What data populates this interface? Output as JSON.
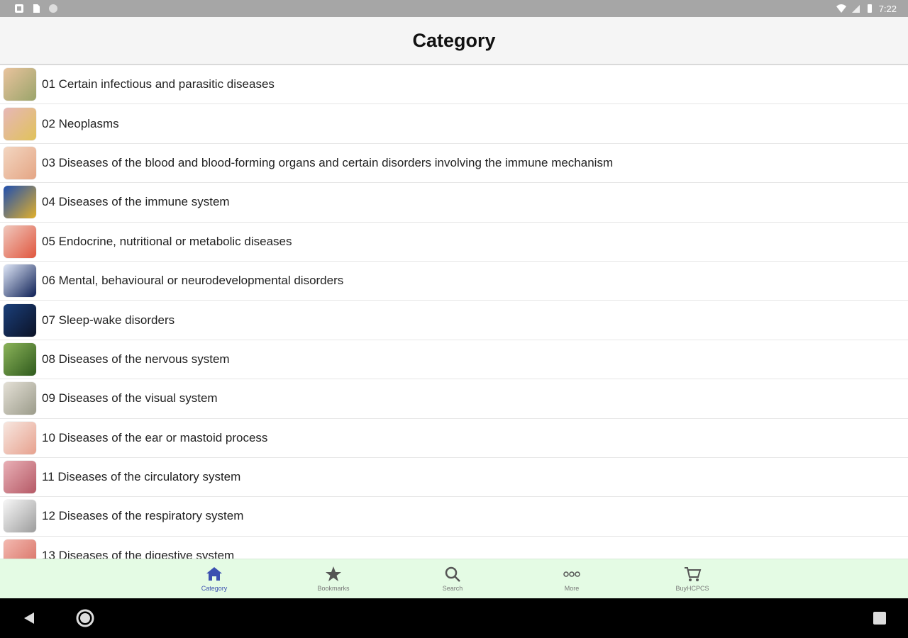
{
  "status_bar": {
    "time": "7:22",
    "left_icons": [
      "notification-icon",
      "sd-card-icon",
      "circle-icon"
    ],
    "right_icons": [
      "wifi-icon",
      "signal-icon",
      "battery-icon"
    ]
  },
  "header": {
    "title": "Category"
  },
  "categories": [
    {
      "label": "01 Certain infectious and parasitic diseases",
      "colors": [
        "#e9c39d",
        "#9aa46a"
      ]
    },
    {
      "label": "02  Neoplasms",
      "colors": [
        "#e7b7b7",
        "#e0c25a"
      ]
    },
    {
      "label": "03  Diseases of the blood and blood-forming organs and certain disorders involving the immune mechanism",
      "colors": [
        "#f3d6c1",
        "#e4a584"
      ]
    },
    {
      "label": "04 Diseases of the immune system",
      "colors": [
        "#1f4fb0",
        "#e2b02a"
      ]
    },
    {
      "label": "05  Endocrine, nutritional or metabolic diseases",
      "colors": [
        "#f0c8bd",
        "#e0563e"
      ]
    },
    {
      "label": "06  Mental, behavioural or neurodevelopmental disorders",
      "colors": [
        "#dfe7f7",
        "#0d1f55"
      ]
    },
    {
      "label": "07 Sleep-wake disorders",
      "colors": [
        "#1b3f7a",
        "#0b1226"
      ]
    },
    {
      "label": "08 Diseases of the nervous system",
      "colors": [
        "#8bb35a",
        "#2f5a1c"
      ]
    },
    {
      "label": "09 Diseases of the visual system",
      "colors": [
        "#e4e0d6",
        "#9b9b8a"
      ]
    },
    {
      "label": "10 Diseases of the ear or mastoid process",
      "colors": [
        "#f7e7e0",
        "#e7a18e"
      ]
    },
    {
      "label": "11 Diseases of the circulatory system",
      "colors": [
        "#e9b0b6",
        "#b55966"
      ]
    },
    {
      "label": "12 Diseases of the respiratory system",
      "colors": [
        "#f7f7f7",
        "#9c9c9c"
      ]
    },
    {
      "label": "13 Diseases of the digestive system",
      "colors": [
        "#f3b9b0",
        "#d66b5f"
      ]
    }
  ],
  "bottom_nav": [
    {
      "label": "Category",
      "icon": "home-icon",
      "active": true
    },
    {
      "label": "Bookmarks",
      "icon": "star-icon",
      "active": false
    },
    {
      "label": "Search",
      "icon": "search-icon",
      "active": false
    },
    {
      "label": "More",
      "icon": "more-icon",
      "active": false
    },
    {
      "label": "BuyHCPCS",
      "icon": "cart-icon",
      "active": false
    }
  ],
  "system_nav": [
    "back-icon",
    "home-circle-icon",
    "recents-icon"
  ],
  "colors": {
    "nav_background": "#e4fbe4",
    "active_accent": "#3b4fb0",
    "status_bar": "#a6a6a6"
  }
}
